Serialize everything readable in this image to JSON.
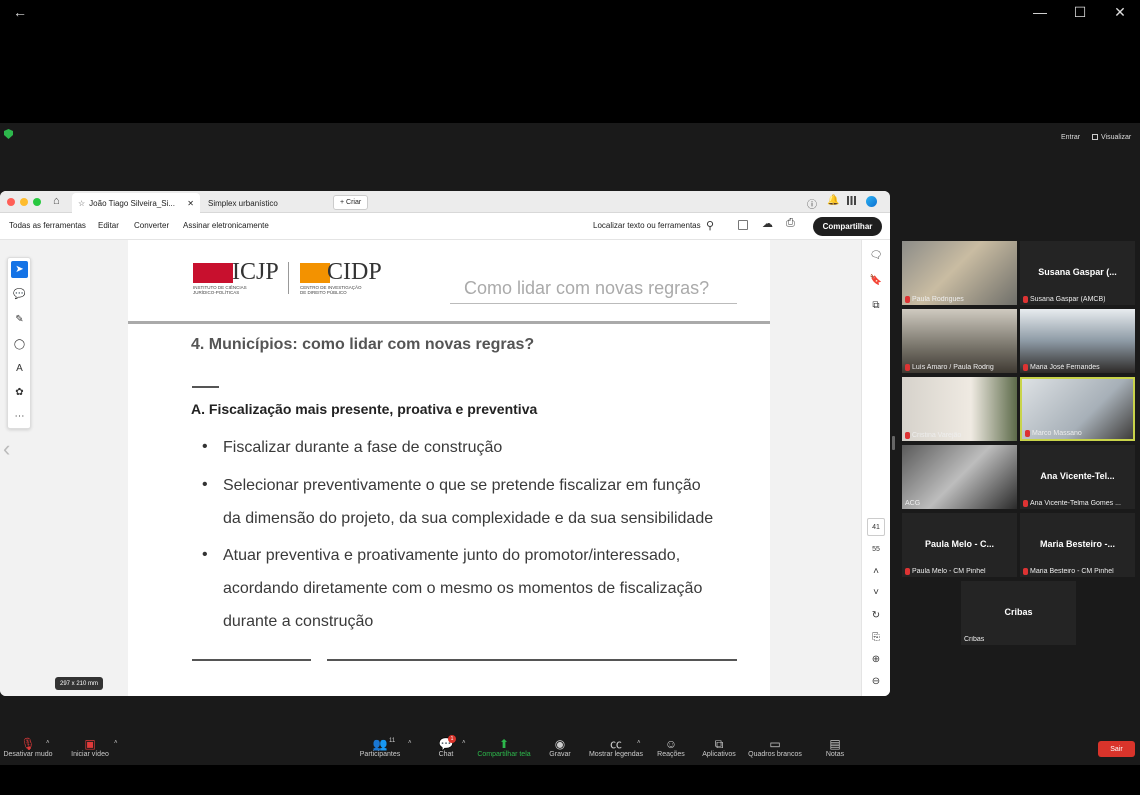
{
  "window": {
    "back_glyph": "←",
    "minimize_glyph": "—",
    "maximize_glyph": "☐",
    "close_glyph": "✕"
  },
  "meeting_top": {
    "enter_label": "Entrar",
    "view_label": "Visualizar"
  },
  "browser": {
    "tabs": [
      {
        "label": "João Tiago Silveira_Si...",
        "close": "✕"
      },
      {
        "label": "Simplex urbanístico"
      }
    ],
    "new_tab_label": "+ Criar",
    "menu": [
      "Todas as ferramentas",
      "Editar",
      "Converter",
      "Assinar eletronicamente"
    ],
    "search_label": "Localizar texto ou ferramentas",
    "share_button": "Compartilhar"
  },
  "slide": {
    "logo_left": "ICJP",
    "logo_left_sub1": "INSTITUTO DE CIÊNCIAS",
    "logo_left_sub2": "JURÍDICO-POLÍTICAS",
    "logo_right": "CIDP",
    "logo_right_sub1": "CENTRO DE INVESTIGAÇÃO",
    "logo_right_sub2": "DE DIREITO PÚBLICO",
    "header_title": "Como lidar com novas regras?",
    "section_title": "4. Municípios: como lidar com novas regras?",
    "subsection": "A. Fiscalização mais presente, proativa e preventiva",
    "bullets": [
      "Fiscalizar durante a fase de construção",
      "Selecionar preventivamente o que se pretende fiscalizar em função",
      "da dimensão do projeto, da sua complexidade e da sua sensibilidade",
      "Atuar preventiva e proativamente junto do promotor/interessado,",
      "acordando diretamente com o mesmo os momentos de fiscalização",
      "durante a construção"
    ],
    "page_size": "297 x 210 mm",
    "page_current": "41",
    "page_total": "55"
  },
  "participants": [
    {
      "name": "Paula Rodrigues",
      "video": true
    },
    {
      "name": "Susana Gaspar (AMCB)",
      "display": "Susana Gaspar (...",
      "video": false
    },
    {
      "name": "Luís Amaro / Paula Rodrig",
      "video": true
    },
    {
      "name": "Maria José Fernandes",
      "video": true
    },
    {
      "name": "Cristina Varejão",
      "video": true
    },
    {
      "name": "Marco Massano",
      "video": true,
      "active": true
    },
    {
      "name": "ACG",
      "video": true
    },
    {
      "name": "Ana Vicente-Telma Gomes ...",
      "display": "Ana Vicente-Tel...",
      "video": false
    },
    {
      "name": "Paula Melo - CM Pinhel",
      "display": "Paula Melo - C...",
      "video": false
    },
    {
      "name": "Maria Besteiro - CM Pinhel",
      "display": "Maria Besteiro -...",
      "video": false
    },
    {
      "name": "Cribas",
      "display": "Cribas",
      "video": false
    }
  ],
  "bottom_bar": {
    "mute": "Desativar mudo",
    "video": "Iniciar vídeo",
    "participants": "Participantes",
    "participants_count": "11",
    "chat": "Chat",
    "chat_badge": "1",
    "share": "Compartilhar tela",
    "record": "Gravar",
    "captions": "Mostrar legendas",
    "reactions": "Reações",
    "apps": "Aplicativos",
    "whiteboards": "Quadros brancos",
    "notes": "Notas",
    "leave": "Sair"
  },
  "colors": {
    "share_green": "#2db84c",
    "leave_red": "#d9342b",
    "active_border": "#c9d44a",
    "icjp_red": "#c8102e",
    "cidp_orange": "#f39200"
  }
}
